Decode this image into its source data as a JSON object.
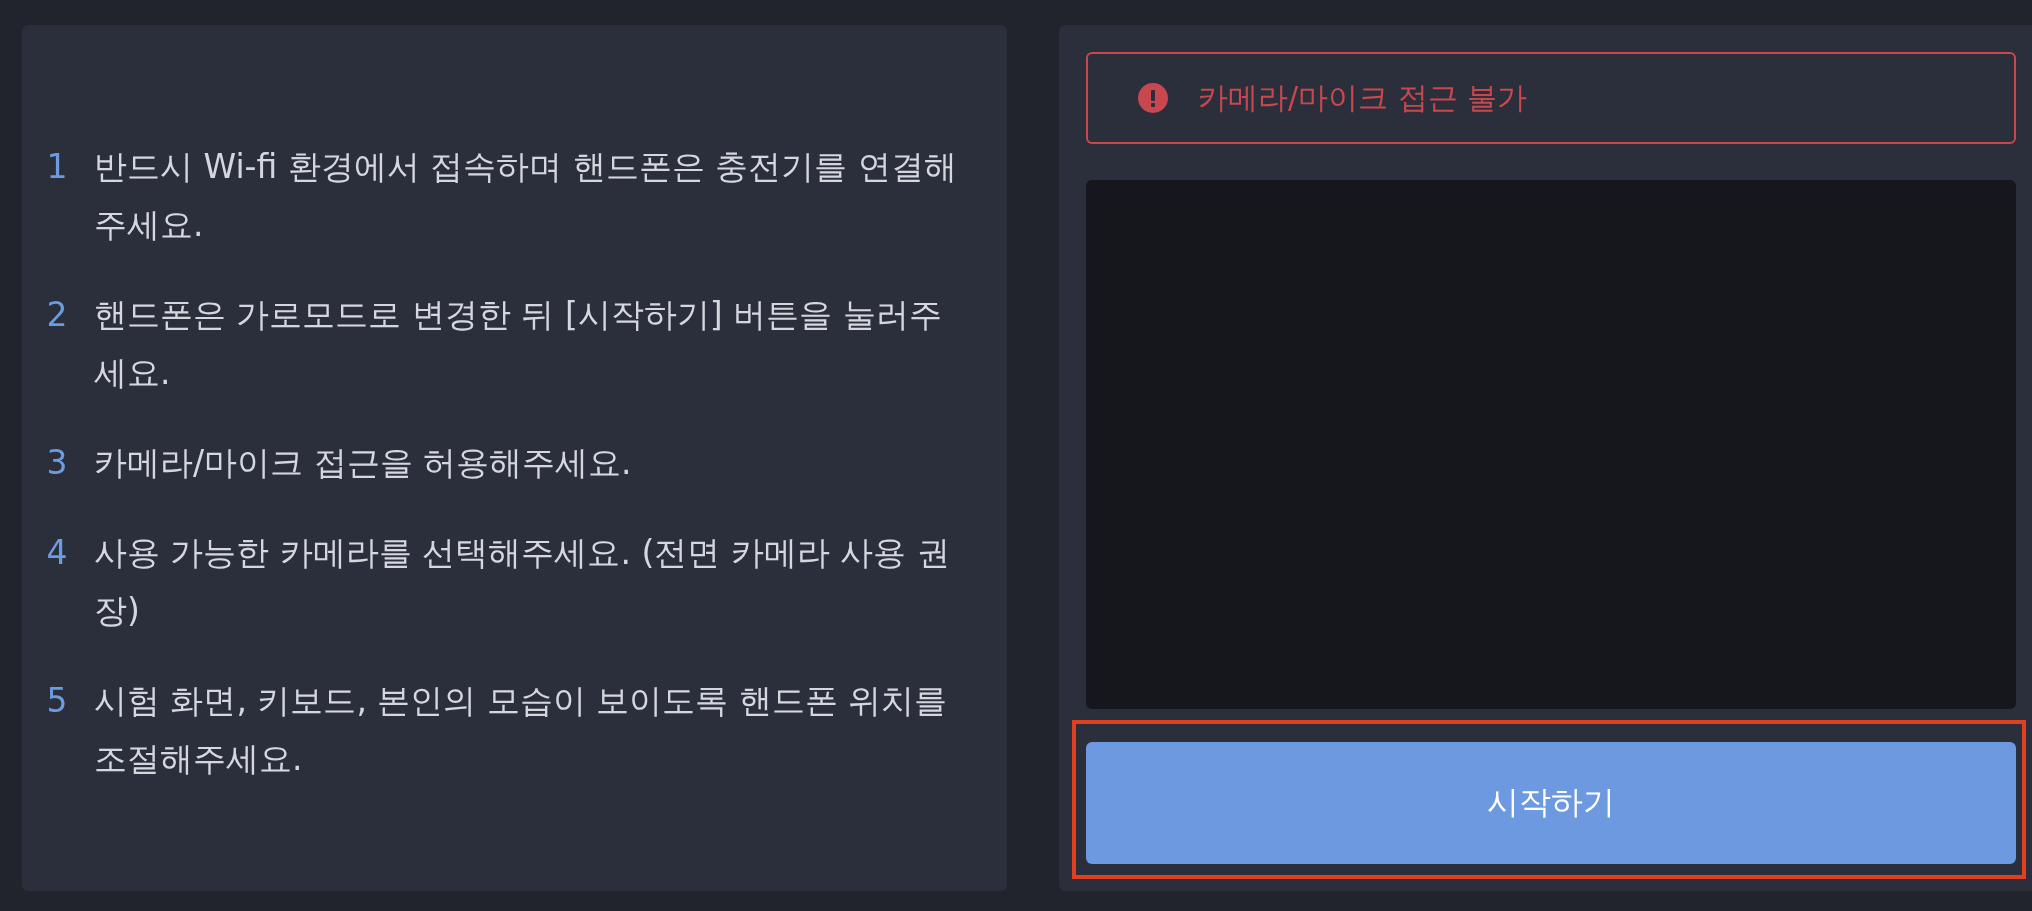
{
  "instructions": [
    {
      "number": "1",
      "text": "반드시 Wi-fi 환경에서 접속하며 핸드폰은 충전기를 연결해주세요."
    },
    {
      "number": "2",
      "text": "핸드폰은 가로모드로 변경한 뒤 [시작하기] 버튼을 눌러주세요."
    },
    {
      "number": "3",
      "text": "카메라/마이크 접근을 허용해주세요."
    },
    {
      "number": "4",
      "text": "사용 가능한 카메라를 선택해주세요. (전면 카메라 사용 권장)"
    },
    {
      "number": "5",
      "text": "시험 화면, 키보드, 본인의 모습이 보이도록 핸드폰 위치를 조절해주세요."
    }
  ],
  "alert": {
    "kind": "error",
    "text": "카메라/마이크 접근 불가"
  },
  "start_button": {
    "label": "시작하기",
    "highlighted": true
  }
}
